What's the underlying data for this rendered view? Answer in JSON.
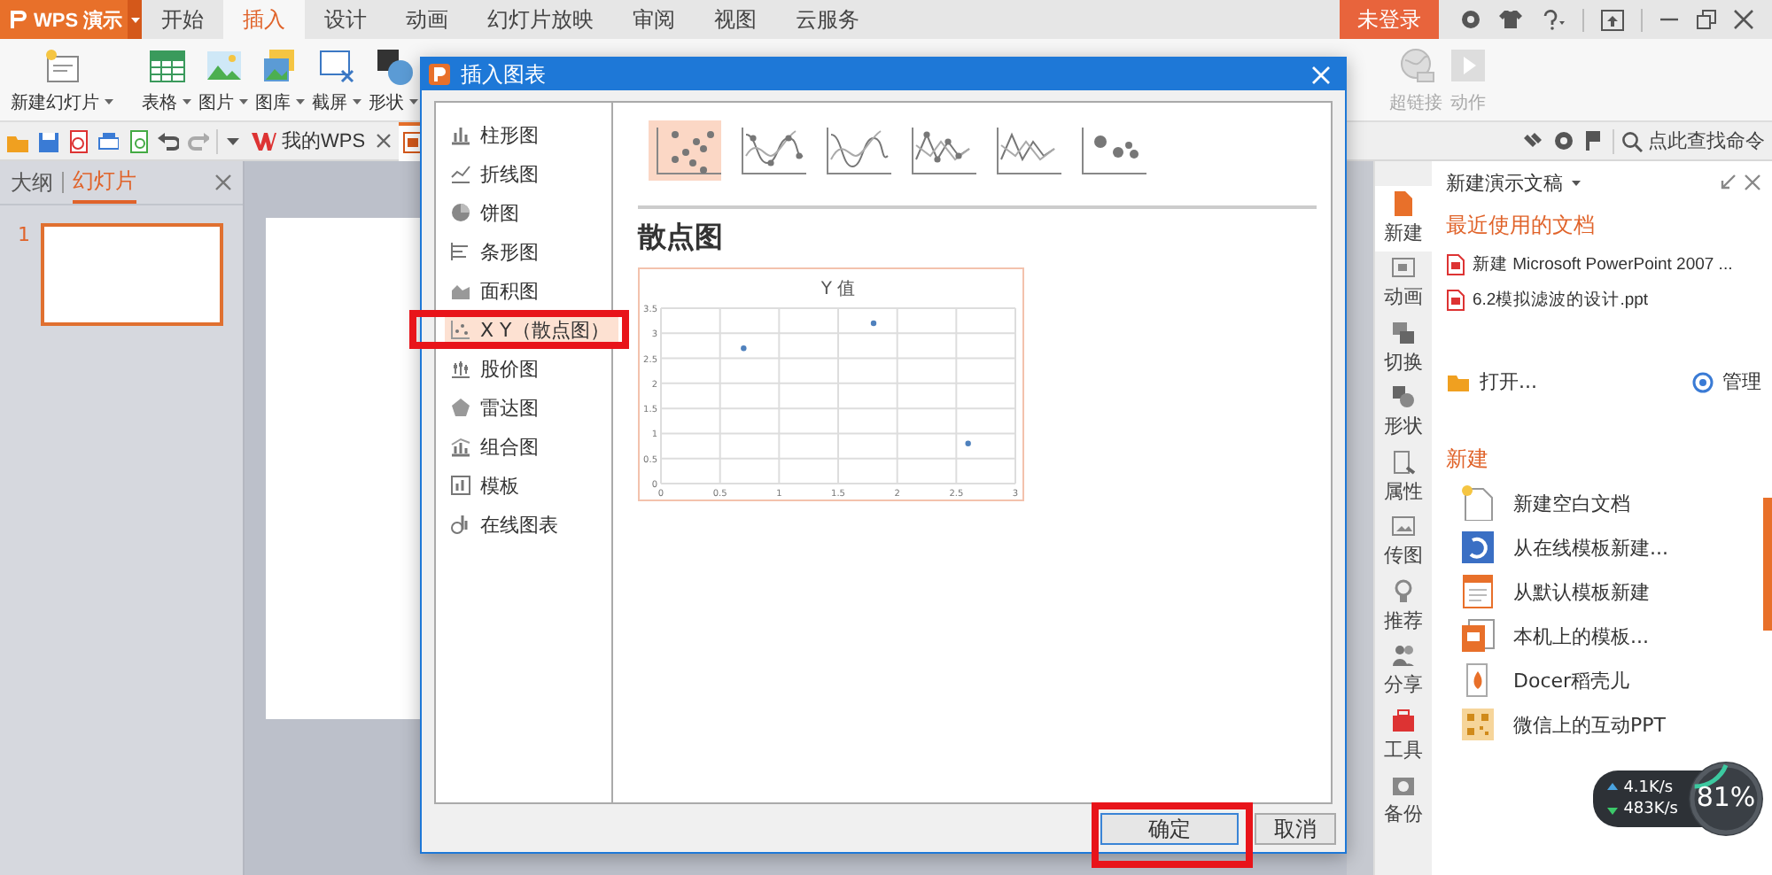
{
  "title_bar": {
    "app_name": "WPS 演示",
    "tabs": [
      {
        "label": "开始",
        "selected": false
      },
      {
        "label": "插入",
        "selected": true
      },
      {
        "label": "设计",
        "selected": false
      },
      {
        "label": "动画",
        "selected": false
      },
      {
        "label": "幻灯片放映",
        "selected": false
      },
      {
        "label": "审阅",
        "selected": false
      },
      {
        "label": "视图",
        "selected": false
      },
      {
        "label": "云服务",
        "selected": false
      }
    ],
    "login_button": "未登录"
  },
  "ribbon": {
    "buttons": [
      {
        "label": "新建幻灯片",
        "dropdown": true,
        "disabled": false
      },
      {
        "label": "表格",
        "dropdown": true,
        "disabled": false
      },
      {
        "label": "图片",
        "dropdown": true,
        "disabled": false
      },
      {
        "label": "图库",
        "dropdown": true,
        "disabled": false
      },
      {
        "label": "截屏",
        "dropdown": true,
        "disabled": false
      },
      {
        "label": "形状",
        "dropdown": true,
        "disabled": false
      },
      {
        "label": "超链接",
        "dropdown": false,
        "disabled": true
      },
      {
        "label": "动作",
        "dropdown": false,
        "disabled": true
      }
    ]
  },
  "quick_bar": {
    "tabs": [
      {
        "label": "我的WPS",
        "selected": false
      },
      {
        "selected": true
      }
    ],
    "search": {
      "placeholder": "点此查找命令"
    }
  },
  "slides_panel": {
    "tabs": [
      {
        "label": "大纲",
        "selected": false
      },
      {
        "label": "幻灯片",
        "selected": true
      }
    ],
    "slides": [
      {
        "number": "1",
        "selected": true
      }
    ]
  },
  "task_pane": {
    "side_tabs": [
      {
        "label": "新建",
        "selected": true
      },
      {
        "label": "动画",
        "selected": false
      },
      {
        "label": "切换",
        "selected": false
      },
      {
        "label": "形状",
        "selected": false
      },
      {
        "label": "属性",
        "selected": false
      },
      {
        "label": "传图",
        "selected": false
      },
      {
        "label": "推荐",
        "selected": false
      },
      {
        "label": "分享",
        "selected": false
      },
      {
        "label": "工具",
        "selected": false
      },
      {
        "label": "备份",
        "selected": false
      }
    ],
    "title": "新建演示文稿",
    "recent_heading": "最近使用的文档",
    "recent_files": [
      "新建 Microsoft PowerPoint 2007 ...",
      "6.2模拟滤波的设计.ppt"
    ],
    "open_label": "打开...",
    "manage_label": "管理",
    "new_heading": "新建",
    "new_items": [
      "新建空白文档",
      "从在线模板新建...",
      "从默认模板新建",
      "本机上的模板...",
      "Docer稻壳儿",
      "微信上的互动PPT"
    ]
  },
  "network_widget": {
    "upload": "4.1K/s",
    "download": "483K/s",
    "percent": "81%"
  },
  "dialog": {
    "title": "插入图表",
    "categories": [
      {
        "label": "柱形图",
        "selected": false,
        "highlighted": false
      },
      {
        "label": "折线图",
        "selected": false,
        "highlighted": false
      },
      {
        "label": "饼图",
        "selected": false,
        "highlighted": false
      },
      {
        "label": "条形图",
        "selected": false,
        "highlighted": false
      },
      {
        "label": "面积图",
        "selected": false,
        "highlighted": false
      },
      {
        "label": "X Y（散点图）",
        "selected": true,
        "highlighted": true
      },
      {
        "label": "股价图",
        "selected": false,
        "highlighted": false
      },
      {
        "label": "雷达图",
        "selected": false,
        "highlighted": false
      },
      {
        "label": "组合图",
        "selected": false,
        "highlighted": false
      },
      {
        "label": "模板",
        "selected": false,
        "highlighted": false
      },
      {
        "label": "在线图表",
        "selected": false,
        "highlighted": false
      }
    ],
    "subtypes": [
      {
        "selected": true
      },
      {
        "selected": false
      },
      {
        "selected": false
      },
      {
        "selected": false
      },
      {
        "selected": false
      },
      {
        "selected": false
      }
    ],
    "preview_title": "散点图",
    "preview": {
      "chart_data": {
        "type": "scatter",
        "grid": true,
        "x": [
          0.7,
          1.8,
          2.6
        ],
        "series": [
          {
            "name": "Y 值",
            "color": "#4f81bd",
            "values": [
              2.7,
              3.2,
              0.8
            ]
          }
        ],
        "xlim": [
          0,
          3
        ],
        "ylim": [
          0,
          3.5
        ],
        "xticks": [
          0,
          0.5,
          1,
          1.5,
          2,
          2.5,
          3
        ],
        "yticks": [
          0,
          0.5,
          1,
          1.5,
          2,
          2.5,
          3,
          3.5
        ]
      }
    },
    "buttons": [
      {
        "label": "确定",
        "default": true,
        "highlighted": true
      },
      {
        "label": "取消",
        "default": false,
        "highlighted": false
      }
    ]
  }
}
